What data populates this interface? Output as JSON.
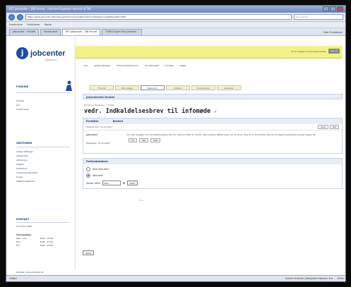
{
  "browser": {
    "title": "RIT jobcenter - DB Forum - Internet Explorer leveret af DK",
    "url": "https://www.jobcenter.dk/index.jsp?action=forum&forumId=123&type=post&threadId=4567",
    "search_placeholder": "Live Search",
    "menu": [
      "Foretrukne",
      "Funktioner",
      "Hjælp"
    ],
    "tabs": [
      "Jobcenter - forside",
      "Foretrukne",
      "RIT jobcenter - DB Forum",
      "TORIG login fuks jobcent..."
    ],
    "tab_tools": "Side  Funktioner",
    "status_left": "Udført",
    "status_zone": "Lokalt intranet | Beskyttet tilstand: Fra",
    "zoom": "100%"
  },
  "logo": {
    "name": "jobcenter",
    "sub": "København"
  },
  "sidebar": {
    "heading": "FORSIDE",
    "links": [
      "Forside",
      "Job",
      "Uddannelse"
    ],
    "section_heading": "SEKTIONER",
    "section_links": [
      "Ledige stillinger",
      "Jobsamtale",
      "Aktivering",
      "Jobplan",
      "Løntilskud",
      "Virksomhedspraktik",
      "Kurser",
      "Støttemuligheder"
    ],
    "contact_heading": "KONTAKT",
    "phone": "Tlf. 7012 3456",
    "hours_heading": "Åbningstider",
    "hours": [
      [
        "Man - ons",
        "8.00 - 15.00"
      ],
      [
        "Tors",
        "8.00 - 17.00"
      ],
      [
        "Fre",
        "8.00 - 13.00"
      ]
    ],
    "footer_link": "Kontakt: jobcenter@kk.dk"
  },
  "topstrip": {
    "login": "Du er logget ind som Jens Jensen",
    "logout": "Log ud"
  },
  "topnav": [
    "Job",
    "Ledige stillinger",
    "Virksomhedsservice",
    "Om jobcenter",
    "Kontakt",
    "Hjælp"
  ],
  "midnav": [
    "Forside",
    "Mine sager",
    "Beskeder",
    "Jobplan",
    "Dokumenter",
    "Kalender"
  ],
  "main": {
    "subhead": "Jobcenterets forside",
    "breadcrumb": "Forside > Beskeder > Forløb",
    "title": "vedr. Indkaldelsesbrev til infomøde",
    "box_headers": [
      "Forfatter",
      "Besked"
    ],
    "meta": "Afsendt den: 12.10.2007",
    "meta_buttons": [
      "Svar",
      "Ret"
    ],
    "author": "Jobcenter",
    "received": "Modtaget: 12.10.2007",
    "message": "Du skal deltage i et informationsmøde den 25. oktober 2007 kl. 10.00 i Jobcenteret. Mødet varer ca. en time. Hvis du er forhindret, skal du kontakte jobcenteret senest dagen før.",
    "msg_buttons": [
      "Vis",
      "Ret",
      "Slet"
    ],
    "fag_header": "Fællesdatabase",
    "radio_1": "Ikke afsluttet",
    "radio_2": "Afsluttet",
    "select_label": "Sorter efter",
    "select_value": "Dato",
    "save_label": "Gem",
    "send_label": "Send",
    "footnote": "Note"
  }
}
